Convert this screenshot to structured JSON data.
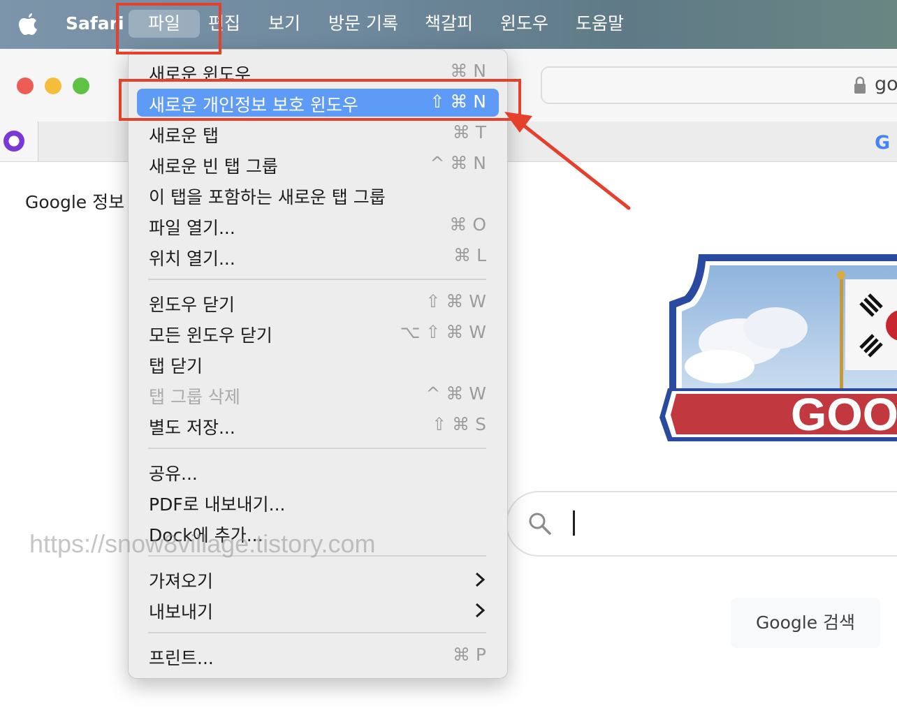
{
  "menubar": {
    "app": "Safari",
    "items": [
      "파일",
      "편집",
      "보기",
      "방문 기록",
      "책갈피",
      "윈도우",
      "도움말"
    ]
  },
  "address": {
    "text": "go"
  },
  "page": {
    "about": "Google 정보",
    "doodle_text": "GOO",
    "search_button": "Google 검색",
    "watermark": "https://snow8village.tistory.com"
  },
  "file_menu": {
    "items": [
      {
        "label": "새로운 윈도우",
        "shortcut": "⌘ N"
      },
      {
        "label": "새로운 개인정보 보호 윈도우",
        "shortcut": "⇧ ⌘ N",
        "highlighted": true
      },
      {
        "label": "새로운 탭",
        "shortcut": "⌘ T"
      },
      {
        "label": "새로운 빈 탭 그룹",
        "shortcut": "^ ⌘ N"
      },
      {
        "label": "이 탭을 포함하는 새로운 탭 그룹",
        "shortcut": ""
      },
      {
        "label": "파일 열기...",
        "shortcut": "⌘ O"
      },
      {
        "label": "위치 열기...",
        "shortcut": "⌘ L"
      },
      {
        "label": "윈도우 닫기",
        "shortcut": "⇧ ⌘ W"
      },
      {
        "label": "모든 윈도우 닫기",
        "shortcut": "⌥ ⇧ ⌘ W"
      },
      {
        "label": "탭 닫기",
        "shortcut": ""
      },
      {
        "label": "탭 그룹 삭제",
        "shortcut": "^ ⌘ W",
        "disabled": true
      },
      {
        "label": "별도 저장...",
        "shortcut": "⇧ ⌘ S"
      },
      {
        "label": "공유...",
        "shortcut": ""
      },
      {
        "label": "PDF로 내보내기...",
        "shortcut": ""
      },
      {
        "label": "Dock에 추가...",
        "shortcut": ""
      },
      {
        "label": "가져오기",
        "submenu": true
      },
      {
        "label": "내보내기",
        "submenu": true
      },
      {
        "label": "프린트...",
        "shortcut": "⌘ P"
      }
    ]
  },
  "colors": {
    "highlight": "#5e9bf6",
    "annotation": "#e5402b"
  }
}
